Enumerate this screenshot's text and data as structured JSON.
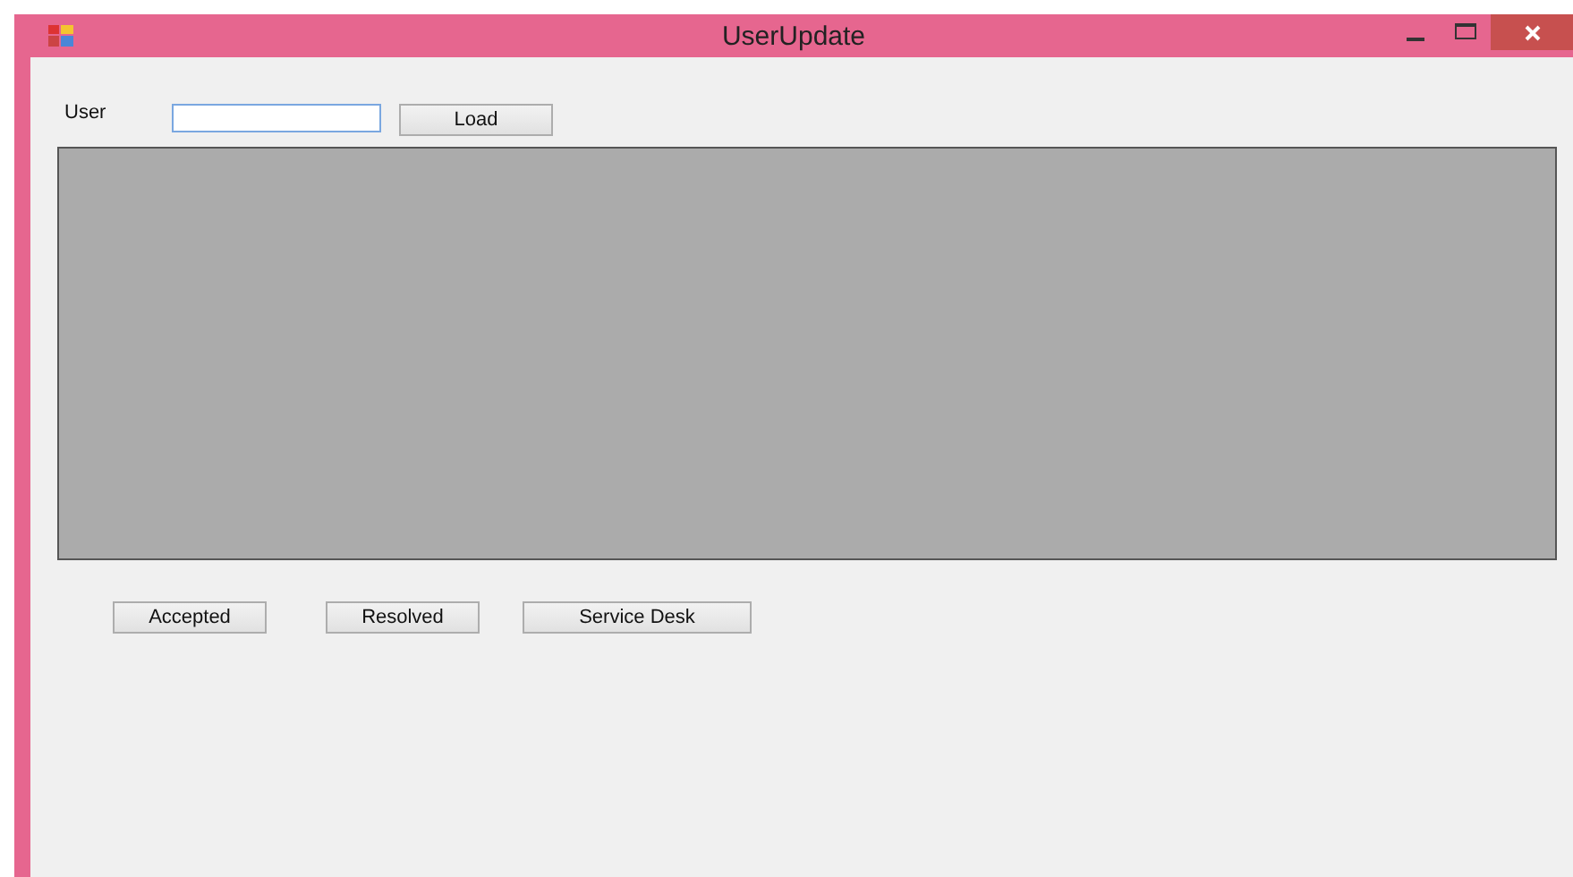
{
  "window": {
    "title": "UserUpdate"
  },
  "user_field": {
    "label": "User"
  },
  "load_button": "Load",
  "buttons": [
    "Accepted",
    "Resolved",
    "Service Desk"
  ]
}
